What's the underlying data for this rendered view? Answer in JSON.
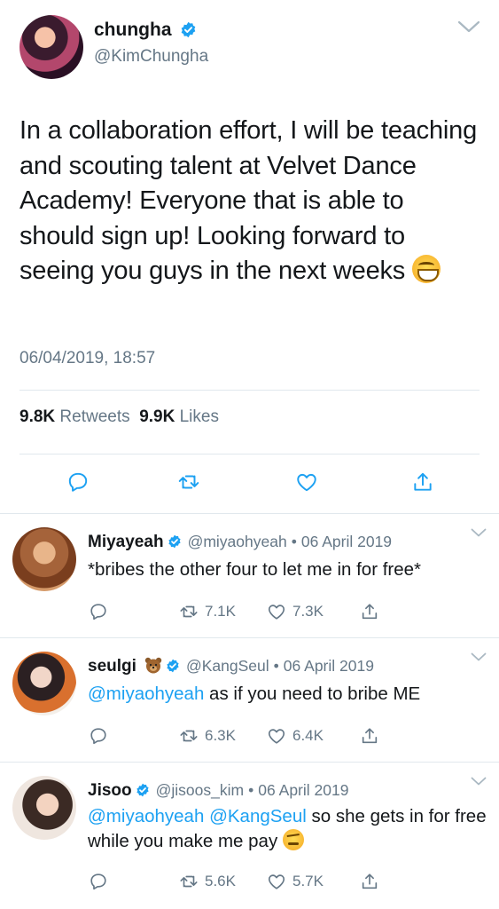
{
  "main_tweet": {
    "name": "chungha",
    "handle": "@KimChungha",
    "text": "In a collaboration effort, I will be teaching and scouting talent at Velvet Dance Academy! Everyone that is able to should sign up! Looking forward to seeing you guys in the next weeks",
    "emoji": "grinning-face-emoji",
    "timestamp": "06/04/2019, 18:57",
    "retweet_count": "9.8K",
    "retweet_label": "Retweets",
    "like_count": "9.9K",
    "like_label": "Likes"
  },
  "replies": [
    {
      "name": "Miyayeah",
      "handle": "@miyaohyeah",
      "date": "06 April 2019",
      "separator": "•",
      "text": "*bribes the other four to let me in for free*",
      "retweets": "7.1K",
      "likes": "7.3K"
    },
    {
      "name": "seulgi",
      "name_emoji": "bear-face-emoji",
      "handle": "@KangSeul",
      "date": "06 April 2019",
      "separator": "•",
      "mention": "@miyaohyeah",
      "text": " as if you need to bribe ME",
      "retweets": "6.3K",
      "likes": "6.4K"
    },
    {
      "name": "Jisoo",
      "handle": "@jisoos_kim",
      "date": "06 April 2019",
      "separator": "•",
      "mention1": "@miyaohyeah",
      "mention2": "@KangSeul",
      "text": " so she gets in for free while you make me pay",
      "emoji": "face-with-raised-eyebrow-emoji",
      "retweets": "5.6K",
      "likes": "5.7K"
    }
  ],
  "colors": {
    "link": "#1da1f2",
    "secondary_text": "#657786",
    "divider": "#e1e8ed",
    "verified": "#1da1f2"
  }
}
